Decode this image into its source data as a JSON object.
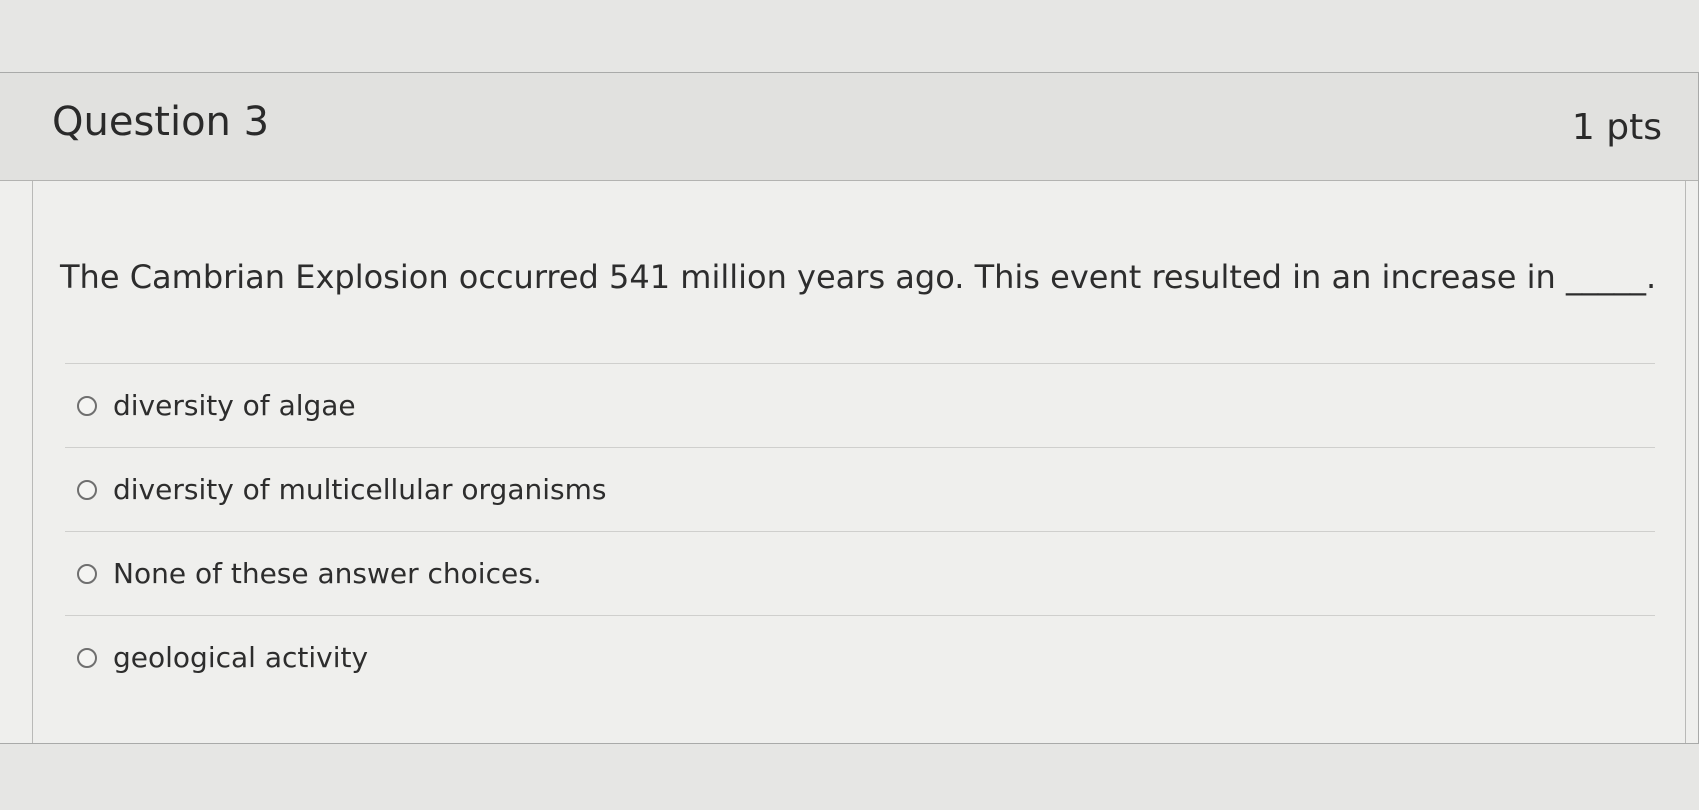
{
  "question": {
    "title": "Question 3",
    "points": "1 pts",
    "text": "The Cambrian Explosion occurred 541 million years ago. This event resulted in an increase in _____."
  },
  "answers": [
    {
      "label": "diversity of algae",
      "selected": false
    },
    {
      "label": "diversity of multicellular organisms",
      "selected": false
    },
    {
      "label": "None of these answer choices.",
      "selected": false
    },
    {
      "label": "geological activity",
      "selected": false
    }
  ]
}
